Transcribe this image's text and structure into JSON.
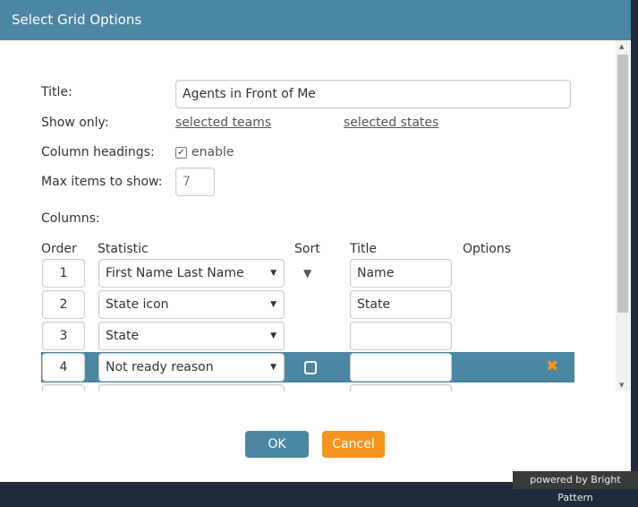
{
  "dialog": {
    "title": "Select Grid Options"
  },
  "form": {
    "title_label": "Title:",
    "title_value": "Agents in Front of Me",
    "show_only_label": "Show only:",
    "selected_teams": "selected teams",
    "selected_states": "selected states",
    "column_headings_label": "Column headings:",
    "enable_label": "enable",
    "enable_checked": true,
    "max_items_label": "Max items to show:",
    "max_items_value": "7",
    "columns_label": "Columns:"
  },
  "columns": {
    "headers": {
      "order": "Order",
      "statistic": "Statistic",
      "sort": "Sort",
      "title": "Title",
      "options": "Options"
    },
    "rows": [
      {
        "order": "1",
        "statistic": "First Name Last Name",
        "title": "Name",
        "sort": "descending"
      },
      {
        "order": "2",
        "statistic": "State icon",
        "title": "State"
      },
      {
        "order": "3",
        "statistic": "State",
        "title": ""
      },
      {
        "order": "4",
        "statistic": "Not ready reason",
        "title": "",
        "selected": true
      }
    ]
  },
  "footer": {
    "ok": "OK",
    "cancel": "Cancel",
    "powered": "powered by Bright Pattern"
  },
  "colors": {
    "header": "#4b86a2",
    "cancel": "#f7941d",
    "remove": "#f7941d"
  }
}
